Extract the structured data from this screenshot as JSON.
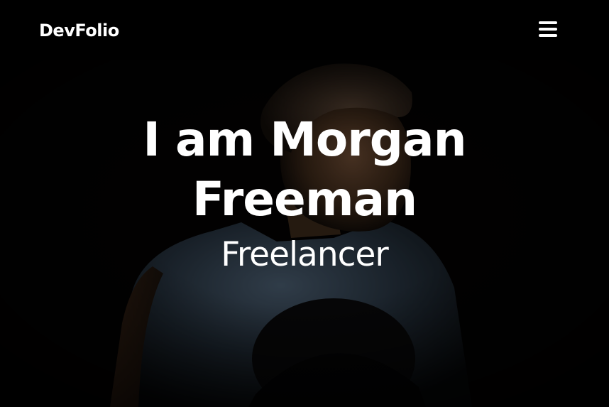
{
  "navbar": {
    "brand": "DevFolio",
    "menu_icon": "hamburger-menu-icon"
  },
  "hero": {
    "title": "I am Morgan Freeman",
    "subtitle": "Freelancer",
    "background_image": "portrait-photo"
  },
  "colors": {
    "background": "#000000",
    "text": "#ffffff",
    "photo_tone": "#3a4a5a"
  }
}
